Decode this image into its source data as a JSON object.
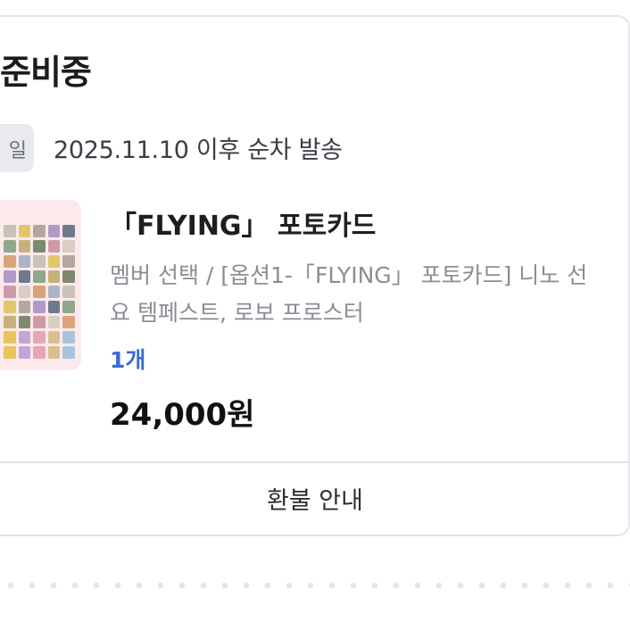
{
  "order": {
    "status": "준비중",
    "date_badge": "일",
    "ship_info": "2025.11.10 이후 순차 발송",
    "product": {
      "title": "「FLYING」 포토카드",
      "option_line1": "멤버 선택 / [옵션1-「FLYING」 포토카드] 니노 선",
      "option_line2": "요 템페스트, 로보 프로스터",
      "quantity": "1개",
      "price": "24,000원"
    },
    "refund_label": "환불 안내"
  },
  "colors": {
    "accent_blue": "#3a6bd6",
    "badge_bg": "#e9eaee",
    "thumb_bg": "#fbe9ec"
  }
}
